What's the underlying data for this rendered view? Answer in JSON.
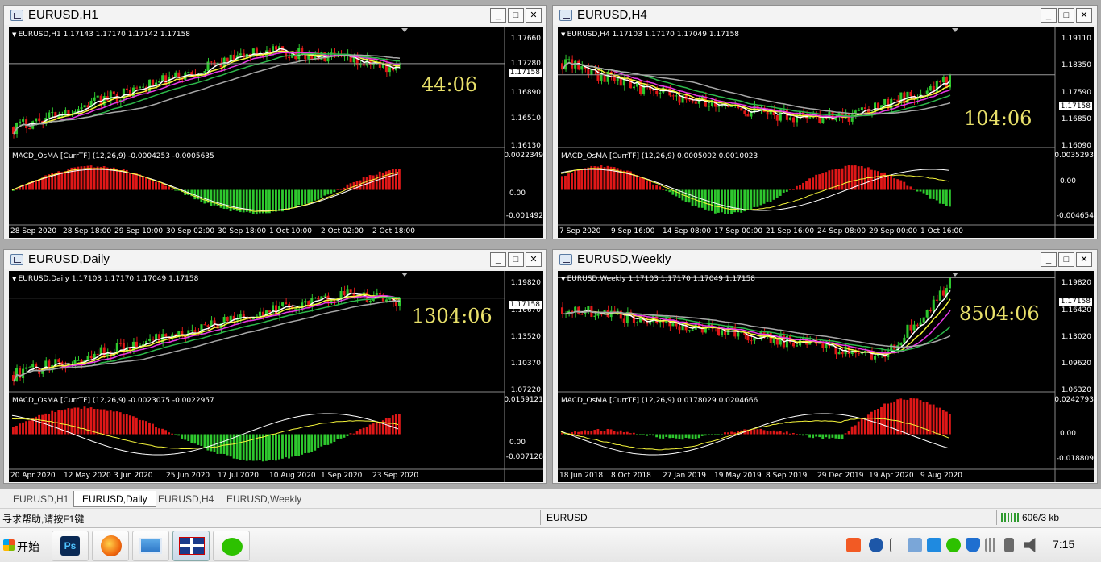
{
  "windows": [
    {
      "title": "EURUSD,H1",
      "price_info": "EURUSD,H1  1.17143 1.17170 1.17142 1.17158",
      "macd_info": "MACD_OsMA [CurrTF] (12,26,9) -0.0004253 -0.0005635",
      "timer": "44:06",
      "current_price": "1.17158",
      "price_ticks": [
        "1.17660",
        "1.17280",
        "1.16890",
        "1.16510",
        "1.16130"
      ],
      "macd_ticks": [
        "0.0022349",
        "0.00",
        "-0.001492"
      ],
      "time_labels": [
        "28 Sep 2020",
        "28 Sep 18:00",
        "29 Sep 10:00",
        "30 Sep 02:00",
        "30 Sep 18:00",
        "1 Oct 10:00",
        "2 Oct 02:00",
        "2 Oct 18:00"
      ]
    },
    {
      "title": "EURUSD,H4",
      "price_info": "EURUSD,H4  1.17103 1.17170 1.17049 1.17158",
      "macd_info": "MACD_OsMA [CurrTF] (12,26,9) 0.0005002 0.0010023",
      "timer": "104:06",
      "current_price": "1.17158",
      "price_ticks": [
        "1.19110",
        "1.18350",
        "1.17590",
        "1.16850",
        "1.16090"
      ],
      "macd_ticks": [
        "0.0035293",
        "0.00",
        "-0.004654"
      ],
      "time_labels": [
        "7 Sep 2020",
        "9 Sep 16:00",
        "14 Sep 08:00",
        "17 Sep 00:00",
        "21 Sep 16:00",
        "24 Sep 08:00",
        "29 Sep 00:00",
        "1 Oct 16:00"
      ]
    },
    {
      "title": "EURUSD,Daily",
      "price_info": "EURUSD,Daily  1.17103 1.17170 1.17049 1.17158",
      "macd_info": "MACD_OsMA [CurrTF] (12,26,9) -0.0023075 -0.0022957",
      "timer": "1304:06",
      "current_price": "1.17158",
      "price_ticks": [
        "1.19820",
        "1.16670",
        "1.13520",
        "1.10370",
        "1.07220"
      ],
      "macd_ticks": [
        "0.0159121",
        "0.00",
        "-0.007128"
      ],
      "time_labels": [
        "20 Apr 2020",
        "12 May 2020",
        "3 Jun 2020",
        "25 Jun 2020",
        "17 Jul 2020",
        "10 Aug 2020",
        "1 Sep 2020",
        "23 Sep 2020"
      ]
    },
    {
      "title": "EURUSD,Weekly",
      "price_info": "EURUSD,Weekly  1.17103 1.17170 1.17049 1.17158",
      "macd_info": "MACD_OsMA [CurrTF] (12,26,9) 0.0178029 0.0204666",
      "timer": "8504:06",
      "current_price": "1.17158",
      "price_ticks": [
        "1.19820",
        "1.16420",
        "1.13020",
        "1.09620",
        "1.06320"
      ],
      "macd_ticks": [
        "0.0242793",
        "0.00",
        "-0.018809"
      ],
      "time_labels": [
        "18 Jun 2018",
        "8 Oct 2018",
        "27 Jan 2019",
        "19 May 2019",
        "8 Sep 2019",
        "29 Dec 2019",
        "19 Apr 2020",
        "9 Aug 2020"
      ]
    }
  ],
  "tabs": [
    "EURUSD,H1",
    "EURUSD,Daily",
    "EURUSD,H4",
    "EURUSD,Weekly"
  ],
  "active_tab": "EURUSD,Daily",
  "status": {
    "help": "寻求帮助,请按F1键",
    "symbol": "EURUSD",
    "traffic": "606/3 kb"
  },
  "taskbar": {
    "start": "开始",
    "clock": "7:15",
    "apps": [
      "photoshop-icon",
      "browser-icon",
      "picture-viewer-icon",
      "metatrader-icon",
      "wechat-icon"
    ]
  },
  "colors": {
    "bull": "#2ec82e",
    "bear": "#e01818",
    "ma_fast": "#ffffff",
    "ma_mid": "#f5f53a",
    "ma_slow": "#e838e8",
    "ma_green": "#2cb84a",
    "ma_gray": "#a8a8a8",
    "timer": "#e8e06a"
  }
}
